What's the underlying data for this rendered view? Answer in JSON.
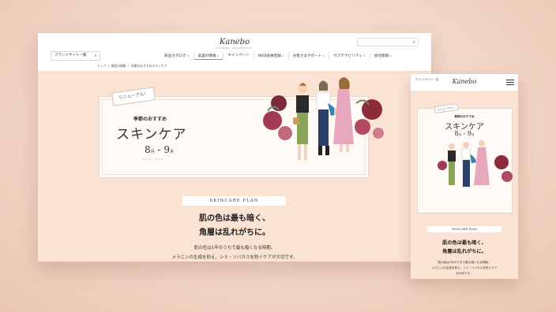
{
  "desktop": {
    "header": {
      "logo": "Kanebo",
      "logo_sub": "KANEBO COSMETICS",
      "search": {
        "placeholder": "",
        "icon": "search-icon"
      },
      "brand_select": "ブランドサイト一覧",
      "nav": [
        "商品カタログ",
        "美容の情報",
        "キャンペーン",
        "WEB会員登録",
        "お客さまサポート",
        "サステナビリティ",
        "会社情報"
      ],
      "active_nav": "美容の情報"
    },
    "breadcrumb": "トップ ＞ 美容の情報 ＞ 季節のおすすめスキンケア",
    "hero": {
      "badge": "リニューアル！",
      "subtitle": "季節のおすすめ",
      "title": "スキンケア",
      "month_from": "8",
      "month_to": "9",
      "month_unit": "月",
      "month_labels": "AUG    SEP"
    },
    "section_label": "SKINCARE PLAN",
    "headline_1": "肌の色は最も暗く、",
    "headline_2": "角層は乱れがちに。",
    "body_1": "肌の色は1年のうちで最も暗くなる時期。",
    "body_2": "メラニンの生成を抑え、シミ・ソバカスを防ぐケアが大切です。"
  },
  "mobile": {
    "brand": "ブランドサイト一覧",
    "logo": "Kanebo",
    "menu_icon": "hamburger-icon",
    "badge": "リニューアル！",
    "subtitle": "季節のおすすめ",
    "title": "スキンケア",
    "month_from": "8",
    "month_to": "9",
    "month_unit": "月",
    "section_label": "SKINCARE PLAN",
    "headline_1": "肌の色は最も暗く、",
    "headline_2": "角層は乱れがちに。",
    "body_1": "肌の色は1年のうちで最も暗くなる時期。",
    "body_2": "メラニンの生成を抑え、シミ・ソバカスを防ぐケア",
    "body_3": "が大切です。"
  },
  "colors": {
    "page_bg": "#fbe3d3",
    "outer_bg": "#f2d6c6",
    "accent_rose": "#8e2b3a",
    "dress_pink": "#e7a7bd",
    "shirt_blue": "#3d7fb5",
    "pants_green": "#8aa45a"
  }
}
